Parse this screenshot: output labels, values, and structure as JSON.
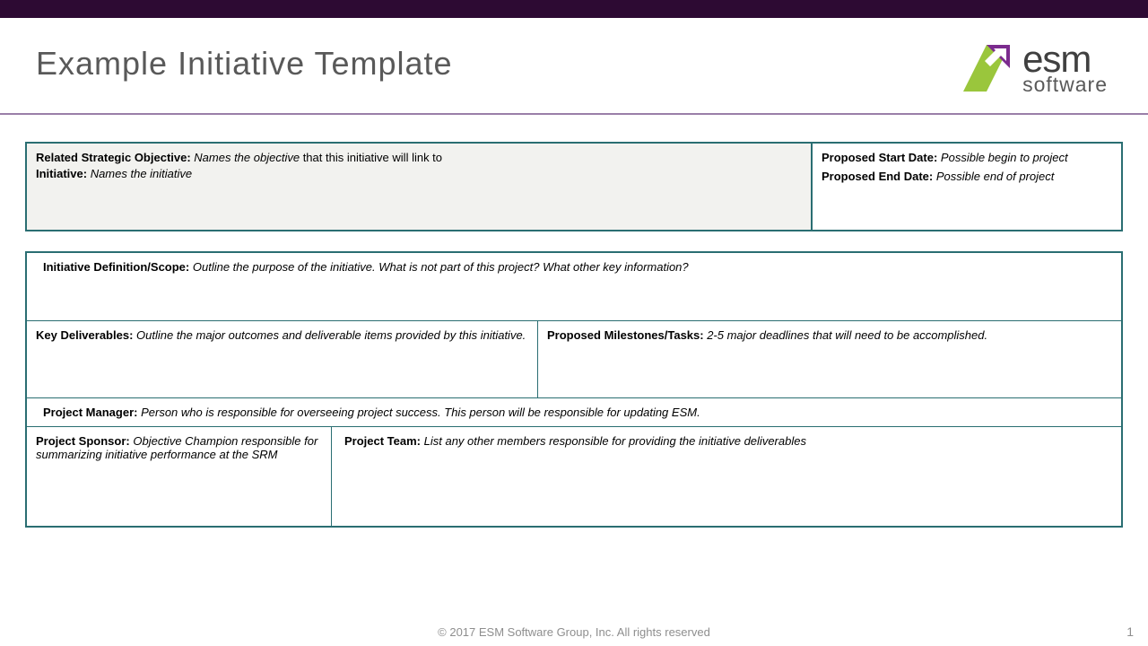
{
  "title": "Example Initiative Template",
  "logo": {
    "esm": "esm",
    "software": "software"
  },
  "box1": {
    "rso_label": "Related Strategic Objective: ",
    "rso_value_a": "Names the objective ",
    "rso_value_b": "that this initiative will link to",
    "initiative_label": "Initiative: ",
    "initiative_value": "Names the initiative",
    "start_label": "Proposed Start Date: ",
    "start_value": "Possible begin to project",
    "end_label": "Proposed End Date: ",
    "end_value": "Possible end of project"
  },
  "box2": {
    "scope_label": "Initiative Definition/Scope:  ",
    "scope_value": "Outline the purpose of the initiative.  What is not part of this project?  What other key information?",
    "kd_label": "Key Deliverables: ",
    "kd_value": "Outline the major outcomes and deliverable items provided by this initiative.",
    "mt_label": "Proposed Milestones/Tasks:   ",
    "mt_value": "2-5 major deadlines that will need to be accomplished.",
    "pm_label": "Project Manager: ",
    "pm_value": "Person who is responsible for overseeing project success.  This person will be responsible for updating ESM.",
    "sponsor_label": "Project Sponsor:  ",
    "sponsor_value": "Objective Champion responsible for summarizing initiative performance at the SRM",
    "team_label": "Project Team: ",
    "team_value": "List any other members responsible for providing the initiative deliverables"
  },
  "footer": "© 2017 ESM Software Group, Inc. All rights reserved",
  "page": "1"
}
